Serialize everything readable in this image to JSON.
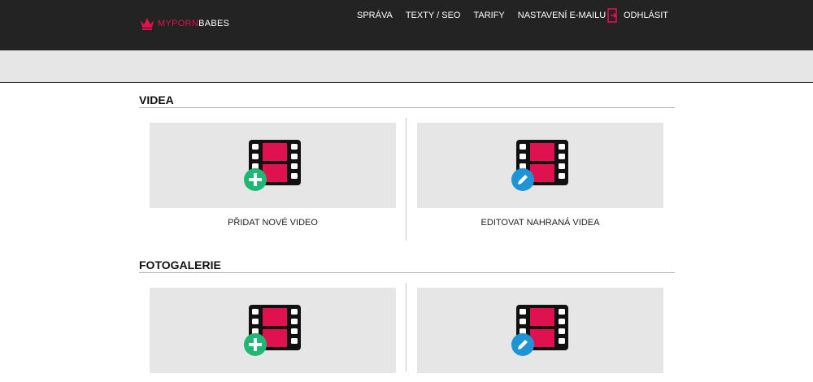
{
  "brand": {
    "name_part1": "MYPORN",
    "name_part2": "BABES",
    "accent_color": "#e0114f",
    "icon": "crown-icon"
  },
  "nav": {
    "items": [
      {
        "label": "SPRÁVA"
      },
      {
        "label": "TEXTY / SEO"
      },
      {
        "label": "TARIFY"
      },
      {
        "label": "NASTAVENÍ E-MAILU"
      }
    ],
    "logout_label": "ODHLÁSIT",
    "logout_icon": "logout-door-icon"
  },
  "sections": [
    {
      "title": "VIDEA",
      "tiles": [
        {
          "label": "PŘIDAT NOVÉ VIDEO",
          "icon": "film-add-icon",
          "badge_color": "#1db874"
        },
        {
          "label": "EDITOVAT NAHRANÁ VIDEA",
          "icon": "film-edit-icon",
          "badge_color": "#1e93d6"
        }
      ]
    },
    {
      "title": "FOTOGALERIE",
      "tiles": [
        {
          "label": "",
          "icon": "film-add-icon",
          "badge_color": "#1db874"
        },
        {
          "label": "",
          "icon": "film-edit-icon",
          "badge_color": "#1e93d6"
        }
      ]
    }
  ]
}
